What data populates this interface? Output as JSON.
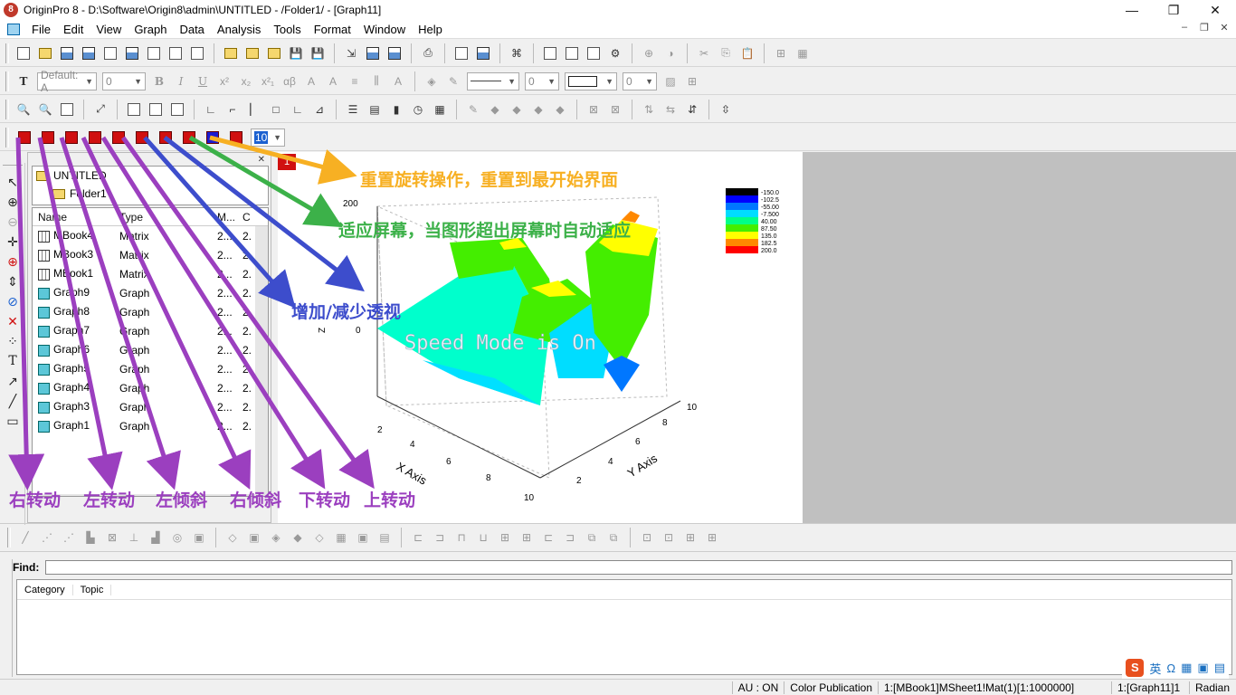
{
  "window": {
    "title": "OriginPro 8 - D:\\Software\\Origin8\\admin\\UNTITLED - /Folder1/ - [Graph11]",
    "app_letter": "8",
    "controls": [
      "—",
      "❐",
      "✕"
    ],
    "mdi_controls": [
      "–",
      "❐",
      "✕"
    ]
  },
  "menu": [
    "File",
    "Edit",
    "View",
    "Graph",
    "Data",
    "Analysis",
    "Tools",
    "Format",
    "Window",
    "Help"
  ],
  "format_toolbar": {
    "font_name": "Default: A",
    "font_size": "0",
    "bold": "B",
    "italic": "I",
    "underline": "U",
    "superscript": "x²",
    "subscript": "x₂",
    "supersub": "x²₁",
    "greek": "αβ",
    "line_width": "0",
    "border_width": "0"
  },
  "rotate_toolbar": {
    "angle_value": "10"
  },
  "explorer": {
    "tree": [
      {
        "label": "UNTITLED"
      },
      {
        "label": "Folder1"
      }
    ],
    "columns": [
      "Name",
      "Type",
      "M...",
      "C"
    ],
    "rows": [
      {
        "name": "MBook4",
        "type": "Matrix",
        "m": "2...",
        "c": "2.",
        "icon": "matrix"
      },
      {
        "name": "MBook3",
        "type": "Matrix",
        "m": "2...",
        "c": "2.",
        "icon": "matrix"
      },
      {
        "name": "MBook1",
        "type": "Matrix",
        "m": "2...",
        "c": "2.",
        "icon": "matrix"
      },
      {
        "name": "Graph9",
        "type": "Graph",
        "m": "2...",
        "c": "2.",
        "icon": "graph"
      },
      {
        "name": "Graph8",
        "type": "Graph",
        "m": "2...",
        "c": "2.",
        "icon": "graph"
      },
      {
        "name": "Graph7",
        "type": "Graph",
        "m": "2...",
        "c": "2.",
        "icon": "graph"
      },
      {
        "name": "Graph6",
        "type": "Graph",
        "m": "2...",
        "c": "2.",
        "icon": "graph"
      },
      {
        "name": "Graph5",
        "type": "Graph",
        "m": "2...",
        "c": "2.",
        "icon": "graph"
      },
      {
        "name": "Graph4",
        "type": "Graph",
        "m": "2...",
        "c": "2.",
        "icon": "graph"
      },
      {
        "name": "Graph3",
        "type": "Graph",
        "m": "2...",
        "c": "2.",
        "icon": "graph"
      },
      {
        "name": "Graph1",
        "type": "Graph",
        "m": "2...",
        "c": "2.",
        "icon": "graph"
      }
    ]
  },
  "graph": {
    "layer_tag": "1",
    "speed_mode_text": "Speed Mode is On",
    "z_axis_label": "Z",
    "x_axis_label": "X Axis",
    "y_axis_label": "Y Axis",
    "z_ticks": [
      "200",
      "0"
    ],
    "x_ticks": [
      "2",
      "4",
      "6",
      "8",
      "10"
    ],
    "y_ticks": [
      "2",
      "4",
      "6",
      "8",
      "10"
    ],
    "legend": [
      {
        "label": "-150.0",
        "color": "#000000"
      },
      {
        "label": "-102.5",
        "color": "#0000ff"
      },
      {
        "label": "-55.00",
        "color": "#0077ff"
      },
      {
        "label": "-7.500",
        "color": "#00ddff"
      },
      {
        "label": "40.00",
        "color": "#00ff88"
      },
      {
        "label": "87.50",
        "color": "#44ee00"
      },
      {
        "label": "135.0",
        "color": "#ffff00"
      },
      {
        "label": "182.5",
        "color": "#ff8800"
      },
      {
        "label": "200.0",
        "color": "#ff0000"
      }
    ]
  },
  "annotations": {
    "reset": "重置旋转操作，重置到最开始界面",
    "fit": "适应屏幕，当图形超出屏幕时自动适应",
    "perspective": "增加/减少透视",
    "rotate_right": "右转动",
    "rotate_left": "左转动",
    "tilt_left": "左倾斜",
    "tilt_right": "右倾斜",
    "rotate_down": "下转动",
    "rotate_up": "上转动"
  },
  "find": {
    "label": "Find:",
    "value": "",
    "columns": [
      "Category",
      "Topic"
    ]
  },
  "status": {
    "au": "AU : ON",
    "theme": "Color Publication",
    "cell": "1:[MBook1]MSheet1!Mat(1)[1:1000000]",
    "graph": "1:[Graph11]1",
    "angle": "Radian"
  },
  "ime": {
    "lang": "英",
    "icons": [
      "Ω",
      "▦",
      "▣",
      "▤"
    ]
  }
}
